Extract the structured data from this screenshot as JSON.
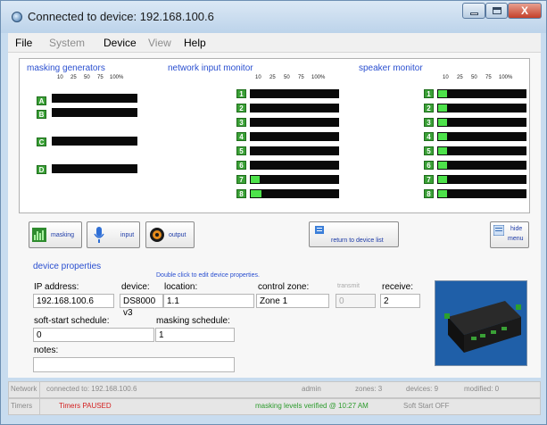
{
  "window": {
    "title": "Connected to device: 192.168.100.6",
    "close_label": "X"
  },
  "menu": [
    {
      "label": "File",
      "enabled": true
    },
    {
      "label": "System",
      "enabled": false
    },
    {
      "label": "Device",
      "enabled": true
    },
    {
      "label": "View",
      "enabled": false
    },
    {
      "label": "Help",
      "enabled": true
    }
  ],
  "monitors": {
    "scale": [
      "10",
      "25",
      "50",
      "75",
      "100%"
    ],
    "masking_generators": {
      "title": "masking generators",
      "channels": [
        {
          "label": "A",
          "level": 0
        },
        {
          "label": "B",
          "level": 0
        },
        {
          "label": "C",
          "level": 0
        },
        {
          "label": "D",
          "level": 0
        }
      ]
    },
    "network_input": {
      "title": "network input monitor",
      "channels": [
        {
          "label": "1",
          "level": 0
        },
        {
          "label": "2",
          "level": 0
        },
        {
          "label": "3",
          "level": 0
        },
        {
          "label": "4",
          "level": 0
        },
        {
          "label": "5",
          "level": 0
        },
        {
          "label": "6",
          "level": 0
        },
        {
          "label": "7",
          "level": 0.1
        },
        {
          "label": "8",
          "level": 0.12
        }
      ]
    },
    "speaker": {
      "title": "speaker monitor",
      "channels": [
        {
          "label": "1",
          "level": 0.1
        },
        {
          "label": "2",
          "level": 0.1
        },
        {
          "label": "3",
          "level": 0.1
        },
        {
          "label": "4",
          "level": 0.1
        },
        {
          "label": "5",
          "level": 0.1
        },
        {
          "label": "6",
          "level": 0.1
        },
        {
          "label": "7",
          "level": 0.1
        },
        {
          "label": "8",
          "level": 0.1
        }
      ]
    }
  },
  "toolbar": {
    "masking": "masking",
    "input": "input",
    "output": "output",
    "return": "return to device list",
    "hide": "hide",
    "menu": "menu"
  },
  "properties": {
    "title": "device properties",
    "hint": "Double click to edit device properties.",
    "ip_label": "IP address:",
    "ip_value": "192.168.100.6",
    "device_label": "device:",
    "device_value": "DS8000 v3",
    "location_label": "location:",
    "location_value": "1.1",
    "zone_label": "control zone:",
    "zone_value": "Zone 1",
    "transmit_label": "transmit",
    "transmit_value": "0",
    "receive_label": "receive:",
    "receive_value": "2",
    "softstart_label": "soft-start schedule:",
    "softstart_value": "0",
    "masking_label": "masking schedule:",
    "masking_value": "1",
    "notes_label": "notes:",
    "notes_value": ""
  },
  "status": {
    "network_label": "Network",
    "connected": "connected to:  192.168.100.6",
    "user": "admin",
    "zones": "zones:  3",
    "devices": "devices:  9",
    "modified": "modified:  0",
    "timers_label": "Timers",
    "timers_state": "Timers PAUSED",
    "verified": "masking levels verified @ 10:27 AM",
    "softstart": "Soft Start OFF"
  },
  "colors": {
    "accent_blue": "#2a4fd0",
    "meter_green": "#4de24a",
    "label_green": "#3aa036",
    "paused_red": "#d42020",
    "verified_green": "#2c9b2c"
  }
}
